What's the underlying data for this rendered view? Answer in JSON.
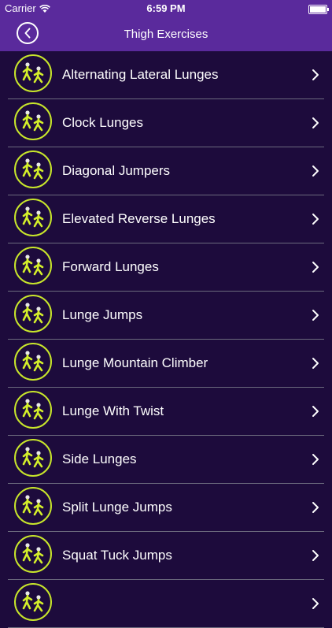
{
  "status_bar": {
    "carrier": "Carrier",
    "time": "6:59 PM",
    "battery_level": 1.0
  },
  "header": {
    "title": "Thigh Exercises",
    "back_icon": "chevron-left-circle-icon"
  },
  "accent": "#c8e62b",
  "exercises": [
    {
      "name": "Alternating Lateral Lunges"
    },
    {
      "name": "Clock Lunges"
    },
    {
      "name": "Diagonal Jumpers"
    },
    {
      "name": "Elevated Reverse Lunges"
    },
    {
      "name": "Forward Lunges"
    },
    {
      "name": "Lunge Jumps"
    },
    {
      "name": "Lunge Mountain Climber"
    },
    {
      "name": "Lunge With Twist"
    },
    {
      "name": "Side Lunges"
    },
    {
      "name": "Split Lunge Jumps"
    },
    {
      "name": "Squat Tuck Jumps"
    },
    {
      "name": ""
    }
  ]
}
